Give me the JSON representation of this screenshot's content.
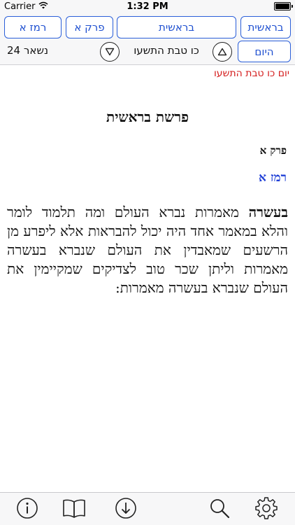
{
  "status_bar": {
    "carrier": "Carrier",
    "time": "1:32 PM",
    "icons": [
      "wifi-icon",
      "battery-icon"
    ]
  },
  "nav": {
    "remez_button": "רמז א",
    "perek_button": "פרק א",
    "sefer_button": "בראשית",
    "parsha_button": "בראשית",
    "today_button": "היום",
    "date": "כו טבת התשעו",
    "remaining": "נשאר 24",
    "icons": [
      "triangle-down-icon",
      "triangle-up-icon"
    ]
  },
  "content": {
    "day_line": "יום כו טבת התשעו",
    "parsha_title": "פרשת בראשית",
    "chapter": "פרק א",
    "remez": "רמז א",
    "text_lead": "בעשרה",
    "text_body": "מאמרות נברא העולם ומה תלמוד לומר והלא במאמר אחד היה יכול להבראות אלא ליפרע מן הרשעים שמאבדין את העולם שנברא בעשרה מאמרות וליתן שכר טוב לצדיקים שמקיימין את העולם שנברא בעשרה מאמרות:"
  },
  "toolbar": {
    "icons": [
      "info-icon",
      "book-icon",
      "download-icon",
      "search-icon",
      "gear-icon"
    ]
  },
  "colors": {
    "accent_blue": "#1e4fd0",
    "date_red": "#d41c1c",
    "bar_background": "#f7f7f8"
  }
}
